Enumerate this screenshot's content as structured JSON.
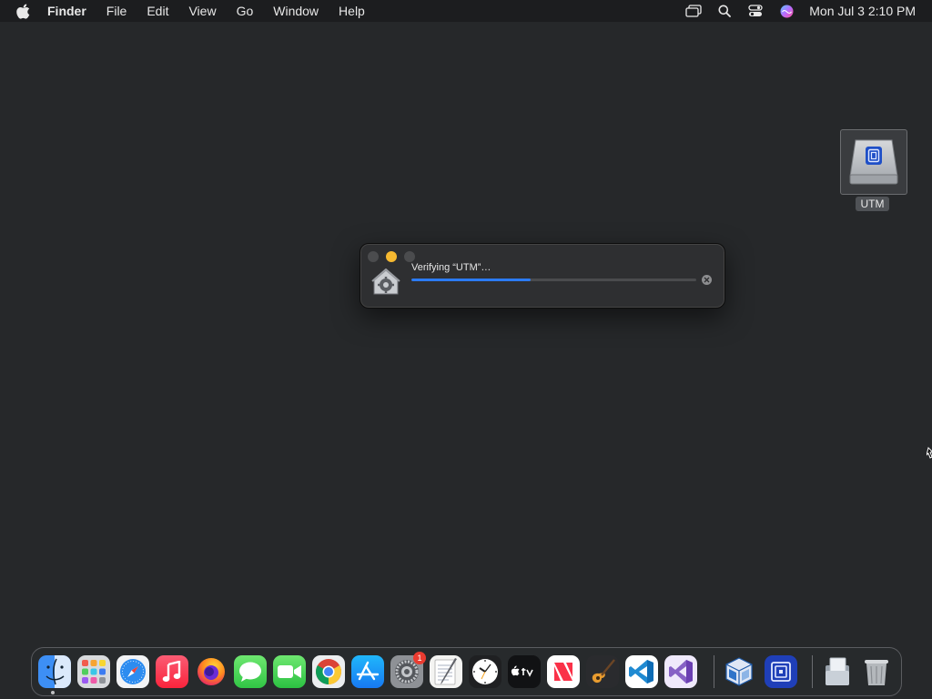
{
  "menubar": {
    "app_name": "Finder",
    "items": [
      "File",
      "Edit",
      "View",
      "Go",
      "Window",
      "Help"
    ],
    "clock": "Mon Jul 3  2:10 PM",
    "status_icons": [
      "screen-mirroring-icon",
      "spotlight-search-icon",
      "control-center-icon",
      "siri-icon"
    ]
  },
  "desktop": {
    "disk_label": "UTM"
  },
  "verify_window": {
    "message": "Verifying “UTM”…",
    "progress_percent": 42
  },
  "dock": {
    "apps": [
      "Finder",
      "Launchpad",
      "Safari",
      "Music",
      "Firefox",
      "Messages",
      "FaceTime",
      "Chrome",
      "App Store",
      "System Settings",
      "TextEdit",
      "Clock",
      "Apple TV",
      "News",
      "GarageBand",
      "Visual Studio Code",
      "Visual Studio",
      "VirtualBox",
      "UTM",
      "Documents",
      "Trash"
    ],
    "settings_badge": "1"
  },
  "colors": {
    "accent": "#2b7bf3",
    "minimize": "#f6b930",
    "badge": "#ea3b30"
  }
}
